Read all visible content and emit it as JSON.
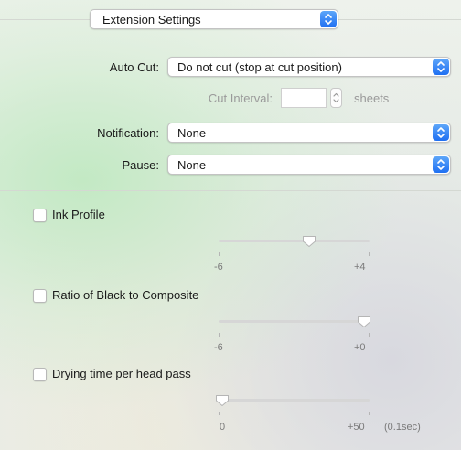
{
  "header_popup": {
    "value": "Extension Settings"
  },
  "auto_cut": {
    "label": "Auto Cut:",
    "value": "Do not cut (stop at cut position)"
  },
  "cut_interval": {
    "label": "Cut Interval:",
    "value": "",
    "unit": "sheets"
  },
  "notification": {
    "label": "Notification:",
    "value": "None"
  },
  "pause": {
    "label": "Pause:",
    "value": "None"
  },
  "ink_profile": {
    "label": "Ink Profile",
    "checked": false,
    "min_label": "-6",
    "max_label": "+4",
    "min": -6,
    "max": 4,
    "value": 0
  },
  "black_ratio": {
    "label": "Ratio of Black to Composite",
    "checked": false,
    "min_label": "-6",
    "max_label": "+0",
    "min": -6,
    "max": 0,
    "value": 0
  },
  "drying_time": {
    "label": "Drying time per head pass",
    "checked": false,
    "min_label": "0",
    "max_label": "+50",
    "unit": "(0.1sec)",
    "min": 0,
    "max": 50,
    "value": 0
  },
  "colors": {
    "accent": "#1f6ff2",
    "accent_light": "#5da6f9"
  },
  "icons": {
    "popup_chevron": "up-down-chevron-icon",
    "stepper": "stepper-arrows-icon"
  }
}
